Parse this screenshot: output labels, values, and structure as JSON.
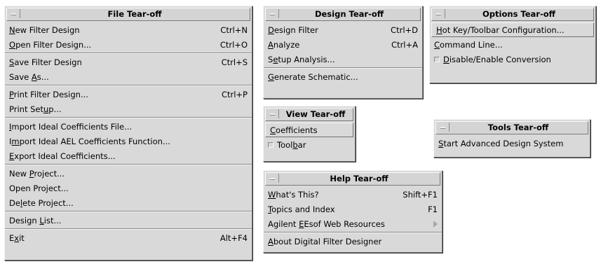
{
  "file_menu": {
    "title": "File Tear-off",
    "groups": [
      [
        {
          "pre": "",
          "u": "N",
          "post": "ew Filter Design",
          "accel": "Ctrl+N"
        },
        {
          "pre": "",
          "u": "O",
          "post": "pen Filter Design...",
          "accel": "Ctrl+O"
        }
      ],
      [
        {
          "pre": "",
          "u": "S",
          "post": "ave Filter Design",
          "accel": "Ctrl+S"
        },
        {
          "pre": "Save ",
          "u": "A",
          "post": "s...",
          "accel": ""
        }
      ],
      [
        {
          "pre": "",
          "u": "P",
          "post": "rint Filter Design...",
          "accel": "Ctrl+P"
        },
        {
          "pre": "Print Set",
          "u": "u",
          "post": "p...",
          "accel": ""
        }
      ],
      [
        {
          "pre": "",
          "u": "I",
          "post": "mport Ideal Coefficients File...",
          "accel": ""
        },
        {
          "pre": "I",
          "u": "m",
          "post": "port Ideal AEL Coefficients Function...",
          "accel": ""
        },
        {
          "pre": "",
          "u": "E",
          "post": "xport Ideal Coefficients...",
          "accel": ""
        }
      ],
      [
        {
          "pre": "New ",
          "u": "P",
          "post": "roject...",
          "accel": ""
        },
        {
          "pre": "Open Pro",
          "u": "j",
          "post": "ect...",
          "accel": ""
        },
        {
          "pre": "De",
          "u": "l",
          "post": "ete Project...",
          "accel": ""
        }
      ],
      [
        {
          "pre": "Design ",
          "u": "L",
          "post": "ist...",
          "accel": ""
        }
      ],
      [
        {
          "pre": "E",
          "u": "x",
          "post": "it",
          "accel": "Alt+F4"
        }
      ]
    ]
  },
  "design_menu": {
    "title": "Design Tear-off",
    "groups": [
      [
        {
          "pre": "",
          "u": "D",
          "post": "esign Filter",
          "accel": "Ctrl+D"
        },
        {
          "pre": "",
          "u": "A",
          "post": "nalyze",
          "accel": "Ctrl+A"
        },
        {
          "pre": "S",
          "u": "e",
          "post": "tup Analysis...",
          "accel": ""
        }
      ],
      [
        {
          "pre": "",
          "u": "G",
          "post": "enerate Schematic...",
          "accel": ""
        }
      ]
    ]
  },
  "options_menu": {
    "title": "Options Tear-off",
    "items": [
      {
        "pre": "",
        "u": "H",
        "post": "ot Key/Toolbar Configuration...",
        "selected": true,
        "indicator": false
      },
      {
        "pre": "",
        "u": "C",
        "post": "ommand Line...",
        "selected": false,
        "indicator": false
      },
      {
        "pre": "",
        "u": "D",
        "post": "isable/Enable Conversion",
        "selected": false,
        "indicator": true
      }
    ]
  },
  "view_menu": {
    "title": "View Tear-off",
    "items": [
      {
        "pre": "",
        "u": "C",
        "post": "oefficients",
        "selected": true,
        "indicator": false
      },
      {
        "pre": "Tool",
        "u": "b",
        "post": "ar",
        "selected": false,
        "indicator": true
      }
    ]
  },
  "tools_menu": {
    "title": "Tools Tear-off",
    "items": [
      {
        "pre": "",
        "u": "S",
        "post": "tart Advanced Design System"
      }
    ]
  },
  "help_menu": {
    "title": "Help Tear-off",
    "groups": [
      [
        {
          "pre": "",
          "u": "W",
          "post": "hat's This?",
          "accel": "Shift+F1",
          "cascade": false
        },
        {
          "pre": "",
          "u": "T",
          "post": "opics and Index",
          "accel": "F1",
          "cascade": false
        },
        {
          "pre": "Agilent ",
          "u": "E",
          "post": "Esof Web Resources",
          "accel": "",
          "cascade": true
        }
      ],
      [
        {
          "pre": "",
          "u": "A",
          "post": "bout Digital Filter Designer",
          "accel": "",
          "cascade": false
        }
      ]
    ]
  },
  "colors": {
    "menu_bg": "#d9d9d9",
    "text": "#000000",
    "desktop": "#ffffff",
    "shadow": "#6e6e6e",
    "highlight": "#f4f4f4"
  }
}
